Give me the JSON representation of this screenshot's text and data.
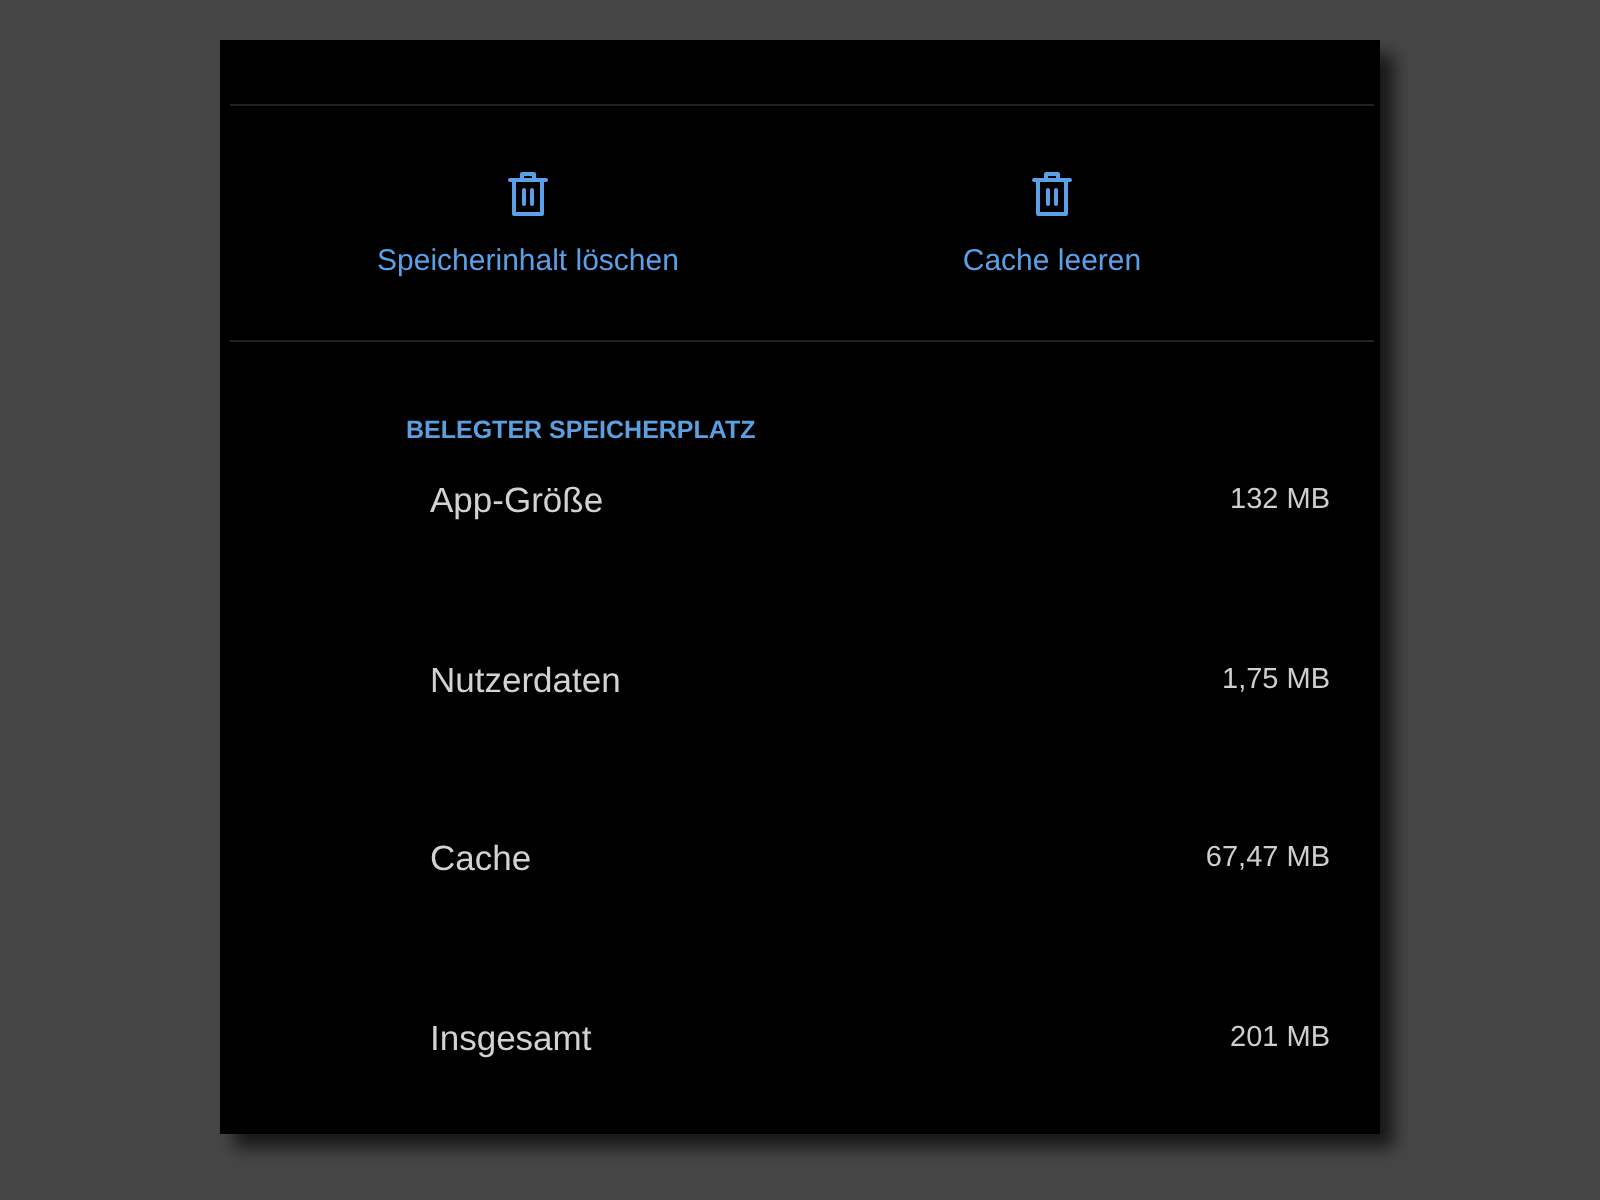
{
  "actions": [
    {
      "label": "Speicherinhalt löschen"
    },
    {
      "label": "Cache leeren"
    }
  ],
  "storage_section": {
    "header": "BELEGTER SPEICHERPLATZ",
    "rows": [
      {
        "label": "App-Größe",
        "value": "132 MB"
      },
      {
        "label": "Nutzerdaten",
        "value": "1,75 MB"
      },
      {
        "label": "Cache",
        "value": "67,47 MB"
      },
      {
        "label": "Insgesamt",
        "value": "201 MB"
      }
    ]
  }
}
